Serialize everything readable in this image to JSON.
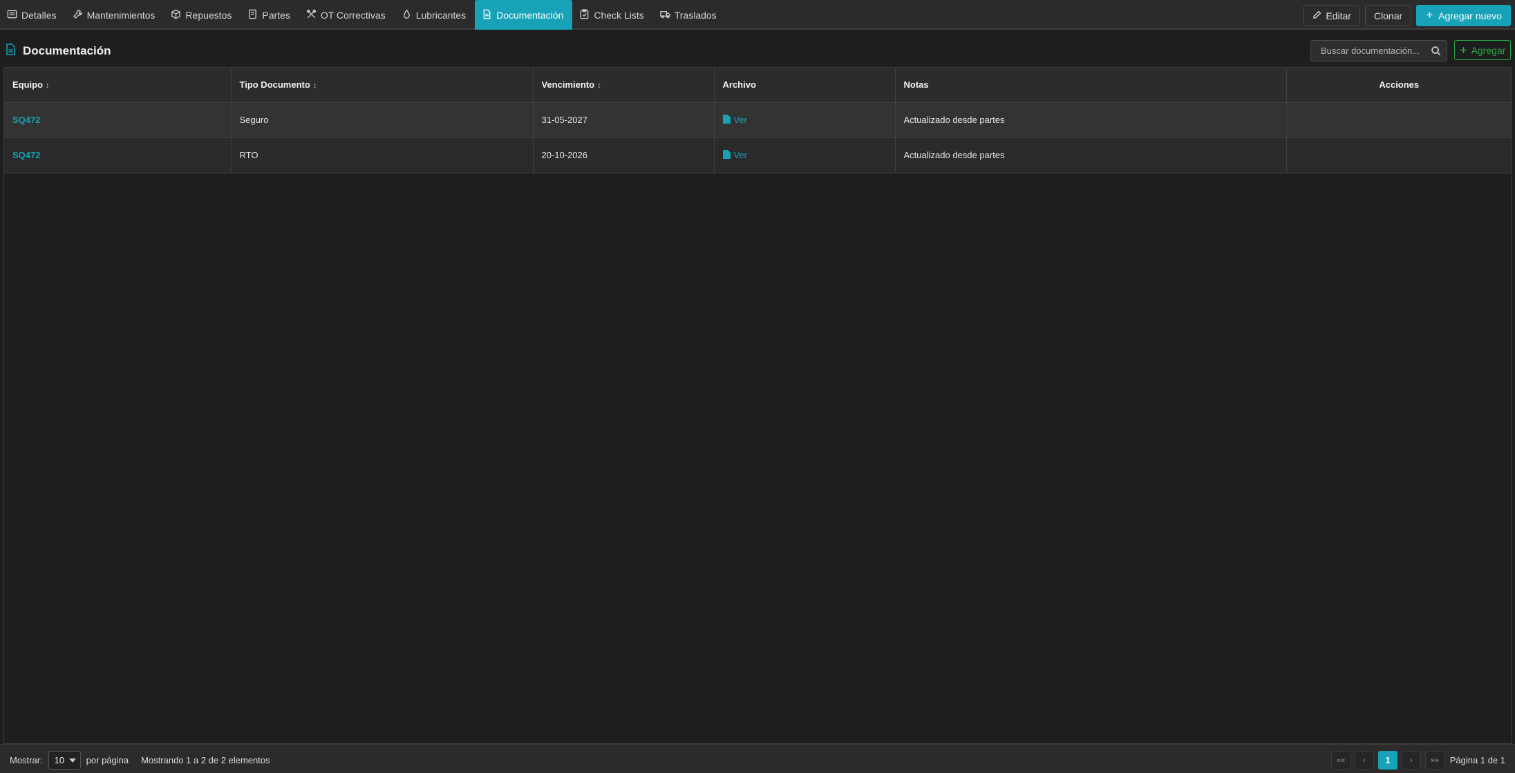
{
  "tabs": [
    {
      "label": "Detalles",
      "icon": "list-icon",
      "active": false
    },
    {
      "label": "Mantenimientos",
      "icon": "wrench-icon",
      "active": false
    },
    {
      "label": "Repuestos",
      "icon": "box-icon",
      "active": false
    },
    {
      "label": "Partes",
      "icon": "document-list-icon",
      "active": false
    },
    {
      "label": "OT Correctivas",
      "icon": "tools-icon",
      "active": false
    },
    {
      "label": "Lubricantes",
      "icon": "droplet-icon",
      "active": false
    },
    {
      "label": "Documentación",
      "icon": "file-text-icon",
      "active": true
    },
    {
      "label": "Check Lists",
      "icon": "clipboard-check-icon",
      "active": false
    },
    {
      "label": "Traslados",
      "icon": "truck-icon",
      "active": false
    }
  ],
  "actions": {
    "edit_label": "Editar",
    "clone_label": "Clonar",
    "add_new_label": "Agregar nuevo"
  },
  "section": {
    "title": "Documentación",
    "search_placeholder": "Buscar documentación...",
    "add_label": "Agregar"
  },
  "table": {
    "columns": {
      "equipo": "Equipo",
      "tipo": "Tipo Documento",
      "vencimiento": "Vencimiento",
      "archivo": "Archivo",
      "notas": "Notas",
      "acciones": "Acciones"
    },
    "rows": [
      {
        "equipo": "SQ472",
        "tipo": "Seguro",
        "vencimiento": "31-05-2027",
        "archivo": "Ver",
        "notas": "Actualizado desde partes",
        "acciones": ""
      },
      {
        "equipo": "SQ472",
        "tipo": "RTO",
        "vencimiento": "20-10-2026",
        "archivo": "Ver",
        "notas": "Actualizado desde partes",
        "acciones": ""
      }
    ]
  },
  "footer": {
    "show_label": "Mostrar:",
    "per_page_value": "10",
    "per_page_label": "por página",
    "count_text": "Mostrando 1 a 2 de 2 elementos",
    "first": "««",
    "prev": "‹",
    "current_page": "1",
    "next": "›",
    "last": "»»",
    "page_info": "Página 1 de 1"
  },
  "colors": {
    "accent": "#17a2b8",
    "success": "#28a745",
    "background": "#1e1e1e"
  }
}
